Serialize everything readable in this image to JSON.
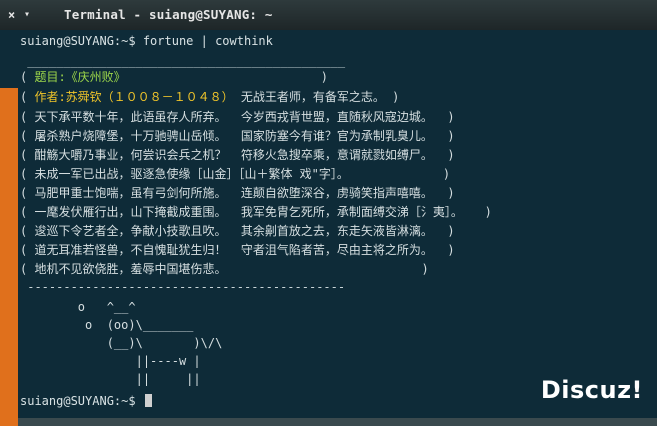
{
  "window": {
    "close_glyph": "×",
    "menu_glyph": "▾",
    "title": "Terminal - suiang@SUYANG: ~"
  },
  "terminal": {
    "command_line": "suiang@SUYANG:~$ fortune | cowthink",
    "top_border": " ____________________________________________",
    "title_line_open": "( ",
    "title_line_text": "题目:《庆州败》",
    "title_line_close": "                           )",
    "author_open": "( ",
    "author_text": "作者:苏舜钦（１００８－１０４８）",
    "author_rest": " 无战王者师，有备军之志。 )",
    "poem_lines": [
      "( 天下承平数十年，此语虽存人所弃。  今岁西戎背世盟，直随秋风寇边城。  )",
      "( 屠杀熟户烧障堡，十万驰骋山岳倾。  国家防塞今有谁？官为承制乳臭儿。  )",
      "( 酣觞大嚼乃事业，何尝识会兵之机？  符移火急搜卒乘，意谓就戮如缚尸。  )",
      "( 未成一军已出战，驱逐急使缘［山金］［山＋繁体 戏\"字］。             )",
      "( 马肥甲重士饱喘，虽有弓剑何所施。  连颠自欲堕深谷，虏骑笑指声嘻嘻。  )",
      "( 一麾发伏雁行出，山下掩截成重围。  我军免胄乞死所，承制面缚交涕［氵夷］。   )",
      "( 逡巡下令艺者全，争献小技歌且吹。  其余劓首放之去，东走矢液皆淋漓。  )",
      "( 道无耳准若怪兽，不自愧耻犹生归！  守者沮气陷者苦，尽由主将之所为。  )",
      "( 地机不见欲侥胜，羞辱中国堪伤悲。                           )"
    ],
    "bottom_border": " --------------------------------------------",
    "cow_lines": [
      "        o   ^__^",
      "         o  (oo)\\_______",
      "            (__)\\       )\\/\\",
      "                ||----w |",
      "                ||     ||"
    ],
    "final_prompt": "suiang@SUYANG:~$ "
  },
  "watermark": "Discuz!",
  "colors": {
    "background": "#0e2b38",
    "accent_bar": "#e0701c",
    "title_yellow": "#f0c52a",
    "title_green": "#9cd64a"
  }
}
